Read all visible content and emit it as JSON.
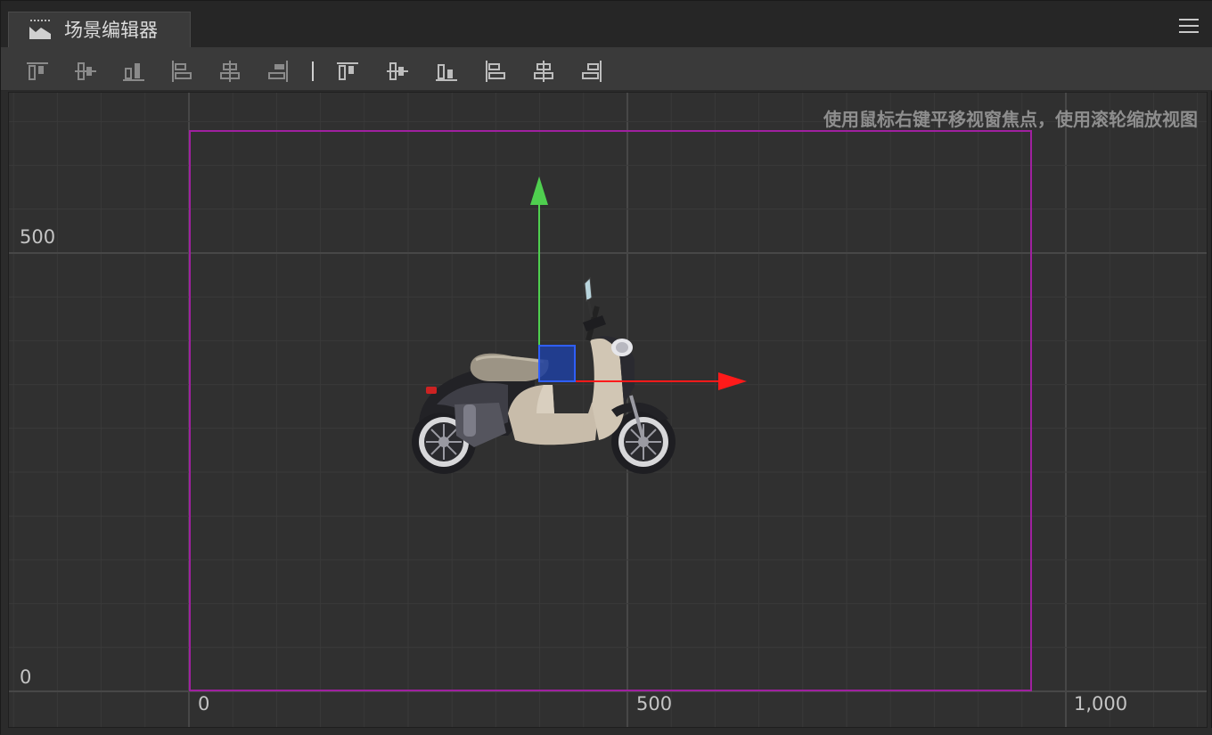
{
  "panel": {
    "tab_title": "场景编辑器",
    "tab_icon": "scene-icon",
    "menu_icon": "hamburger-menu-icon"
  },
  "toolbar": {
    "items": [
      {
        "name": "align-top-icon"
      },
      {
        "name": "align-vertical-center-icon"
      },
      {
        "name": "align-bottom-icon"
      },
      {
        "name": "align-left-icon"
      },
      {
        "name": "align-horizontal-center-icon"
      },
      {
        "name": "align-right-icon"
      },
      {
        "name": "distribute-top-icon"
      },
      {
        "name": "distribute-vertical-center-icon"
      },
      {
        "name": "distribute-bottom-icon"
      },
      {
        "name": "distribute-left-icon"
      },
      {
        "name": "distribute-horizontal-center-icon"
      },
      {
        "name": "distribute-right-icon"
      }
    ]
  },
  "viewport": {
    "hint": "使用鼠标右键平移视窗焦点，使用滚轮缩放视图",
    "x_labels": [
      "0",
      "500",
      "1,000"
    ],
    "y_labels": [
      "500",
      "0"
    ],
    "colors": {
      "background": "#303030",
      "grid_minor": "#3a3a3a",
      "grid_major": "#474747",
      "canvas_border": "#a020a0",
      "gizmo_x": "#ff1a1a",
      "gizmo_y": "#4fcf4f",
      "gizmo_center": "#1f3f9f"
    },
    "node": {
      "name": "scooter-sprite"
    }
  }
}
